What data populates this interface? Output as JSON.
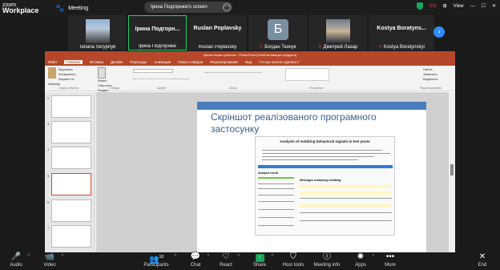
{
  "app": {
    "logo_top": "zoom",
    "logo_bottom": "Workplace",
    "meeting_label": "Meeting",
    "lang": "EN",
    "view_label": "View"
  },
  "share_banner": {
    "text": "Ірина Подгорнюк's screen"
  },
  "participants": [
    {
      "name": "Tetiana Skrypnyk"
    },
    {
      "name": "Ірина Подгорнюк",
      "title": "Ірина Подгорн..."
    },
    {
      "name": "Ruslan Poplavsky",
      "title": "Ruslan Poplavsky"
    },
    {
      "name": "Богдан Ткачук",
      "initial": "Б"
    },
    {
      "name": "Дмитрий Лазар"
    },
    {
      "name": "Kostya Boratynskyi",
      "title": "Kostya Boratyns..."
    }
  ],
  "powerpoint": {
    "window_title": "презентация практика - PowerPoint (Сбой активации продукта)",
    "tabs": [
      "Файл",
      "Главная",
      "Вставка",
      "Дизайн",
      "Переходы",
      "Анимация",
      "Показ слайдов",
      "Рецензирование",
      "Вид",
      "Что вы хотите сделать?"
    ],
    "ribbon": {
      "clipboard": [
        "Вырезать",
        "Копировать",
        "Формат по образцу"
      ],
      "clipboard_label": "Буфер обмена",
      "slides": [
        "Макет",
        "Сбросить",
        "Раздел"
      ],
      "slides_label": "Слайды",
      "font_label": "Шрифт",
      "paragraph_label": "Абзац",
      "drawing_label": "Рисование",
      "edit": [
        "Найти",
        "Заменить",
        "Выделить"
      ],
      "edit_label": "Редактирование"
    },
    "thumbnail_numbers": [
      "2",
      "3",
      "4",
      "5",
      "6",
      "7"
    ],
    "slide": {
      "title": "Скріншот реалізованого програмного застосунку",
      "screenshot_heading": "Analysis of mobbing behavioral signals in text posts",
      "screenshot_section_a": "Analysis result",
      "screenshot_section_b": "Messages containing mobbing:"
    }
  },
  "toolbar": [
    {
      "label": "Audio",
      "icon": "microphone-icon",
      "glyph": "🎤"
    },
    {
      "label": "Video",
      "icon": "video-camera-icon",
      "glyph": "📹"
    },
    {
      "label": "Participants",
      "icon": "participants-icon",
      "glyph": "👥",
      "count": "18"
    },
    {
      "label": "Chat",
      "icon": "chat-icon",
      "glyph": "💬"
    },
    {
      "label": "React",
      "icon": "react-icon",
      "glyph": "♡"
    },
    {
      "label": "Share",
      "icon": "share-screen-icon",
      "glyph": "↑"
    },
    {
      "label": "Host tools",
      "icon": "shield-icon",
      "glyph": "⛉"
    },
    {
      "label": "Meeting info",
      "icon": "info-icon",
      "glyph": "ⓘ"
    },
    {
      "label": "Apps",
      "icon": "apps-icon",
      "glyph": "✺"
    },
    {
      "label": "More",
      "icon": "more-icon",
      "glyph": "•••"
    },
    {
      "label": "End",
      "icon": "end-icon",
      "glyph": "✕"
    }
  ]
}
